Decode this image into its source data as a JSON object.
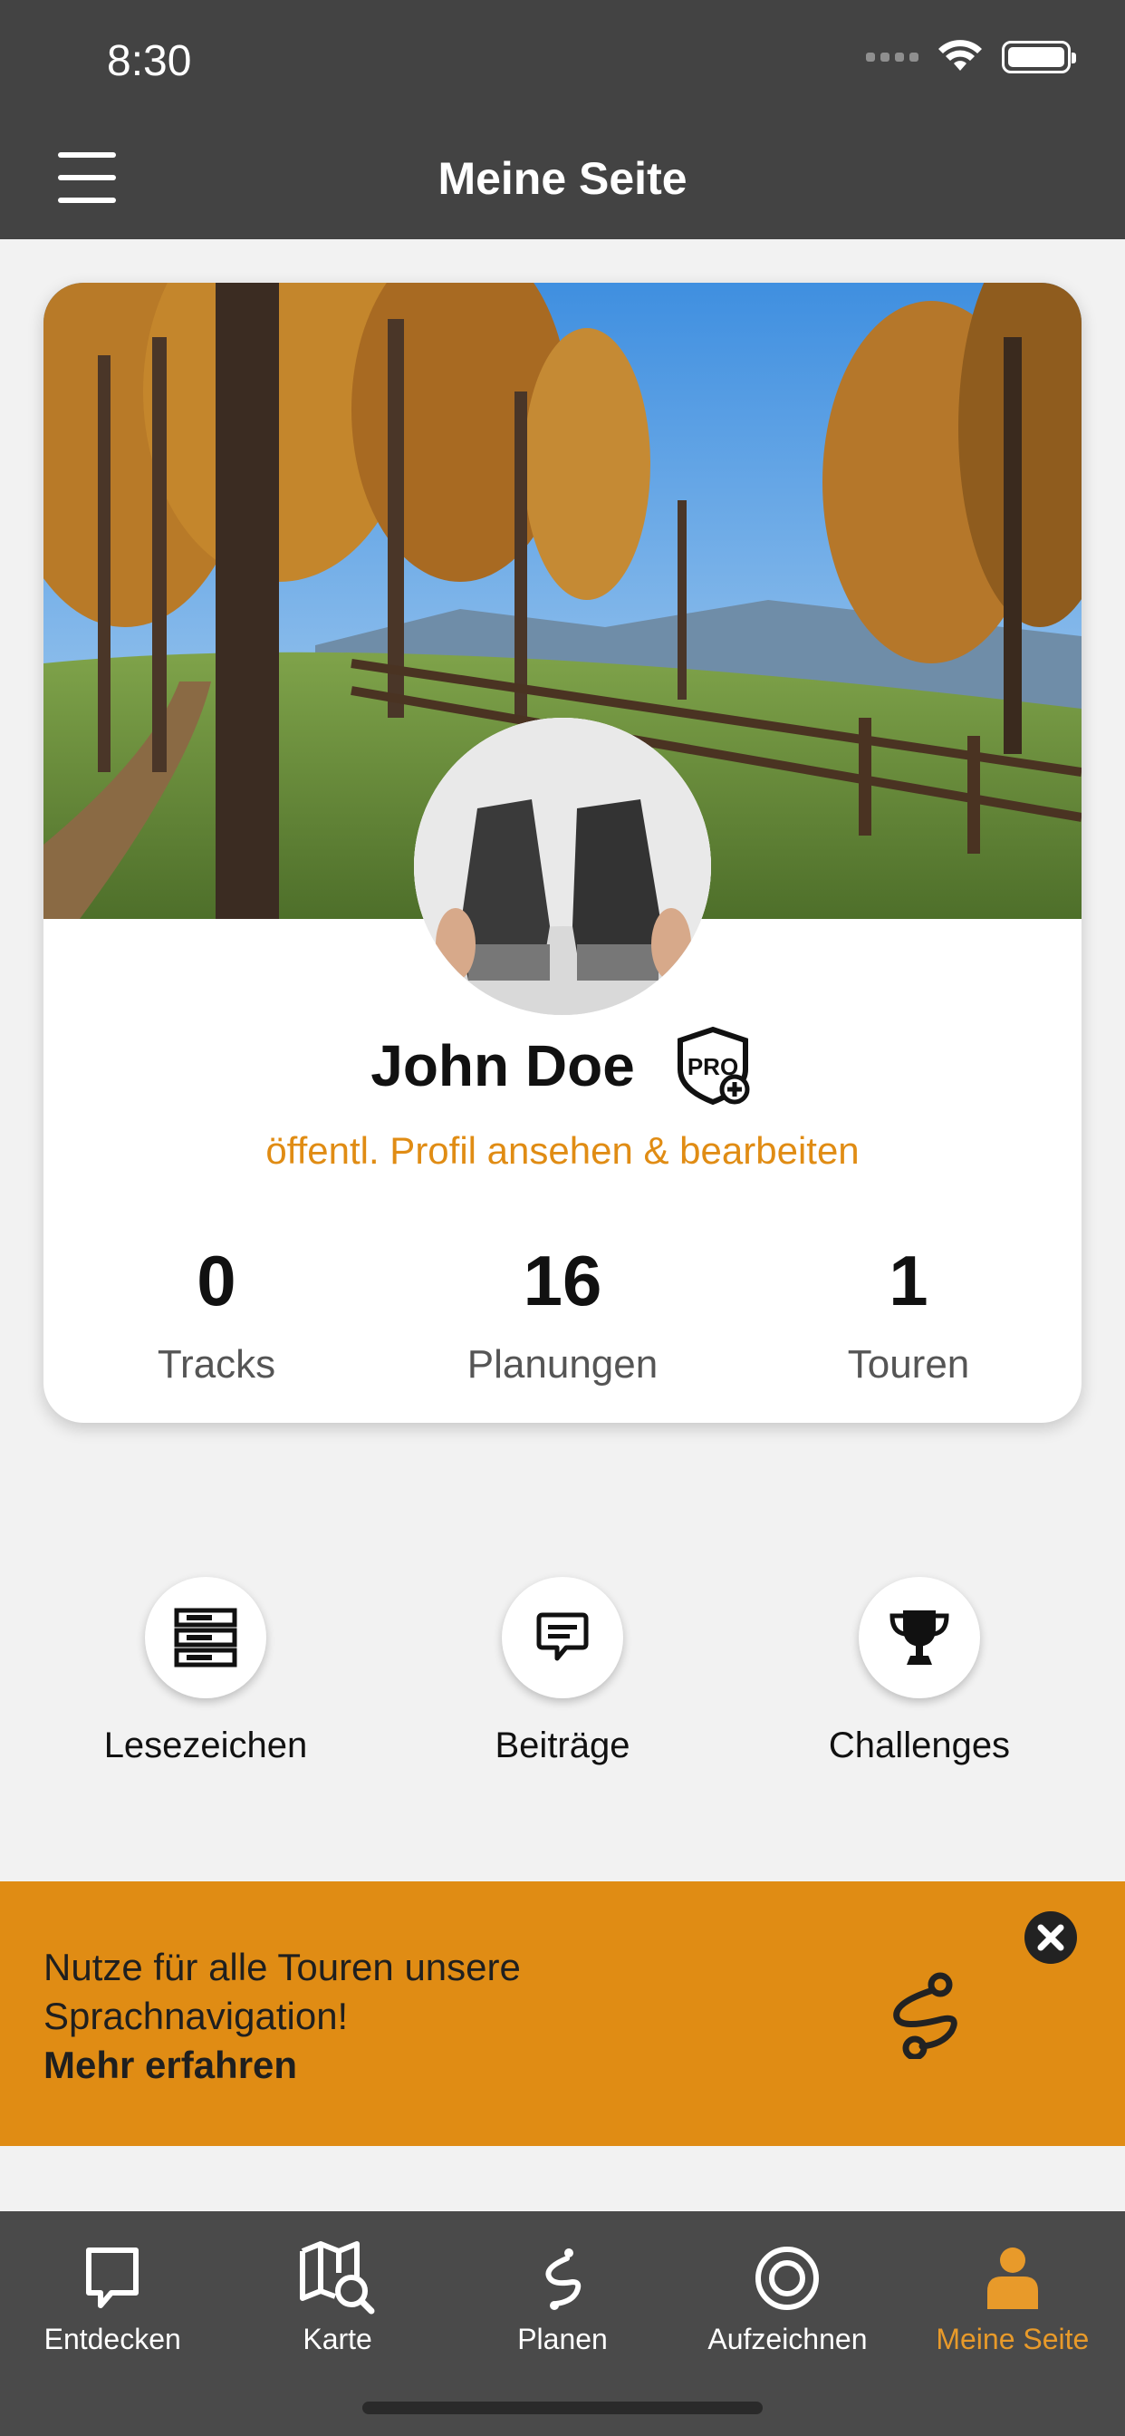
{
  "status_bar": {
    "time": "8:30"
  },
  "header": {
    "title": "Meine Seite"
  },
  "profile": {
    "name": "John Doe",
    "badge": "PRO",
    "profile_link": "öffentl. Profil ansehen & bearbeiten",
    "stats": [
      {
        "value": "0",
        "label": "Tracks"
      },
      {
        "value": "16",
        "label": "Planungen"
      },
      {
        "value": "1",
        "label": "Touren"
      }
    ]
  },
  "actions": [
    {
      "label": "Lesezeichen",
      "icon": "bookmark-list-icon"
    },
    {
      "label": "Beiträge",
      "icon": "chat-bubble-icon"
    },
    {
      "label": "Challenges",
      "icon": "trophy-icon"
    }
  ],
  "banner": {
    "text": "Nutze für alle Touren unsere Sprachnavigation!",
    "link": "Mehr erfahren",
    "icon": "route-icon"
  },
  "tabbar": {
    "tabs": [
      {
        "label": "Entdecken",
        "icon": "discover-icon"
      },
      {
        "label": "Karte",
        "icon": "map-search-icon"
      },
      {
        "label": "Planen",
        "icon": "plan-route-icon"
      },
      {
        "label": "Aufzeichnen",
        "icon": "record-icon"
      },
      {
        "label": "Meine Seite",
        "icon": "user-icon"
      }
    ],
    "active_index": 4
  },
  "colors": {
    "accent": "#e08c14",
    "header_bg": "#434343",
    "tabbar_bg": "#4a4a4a"
  }
}
